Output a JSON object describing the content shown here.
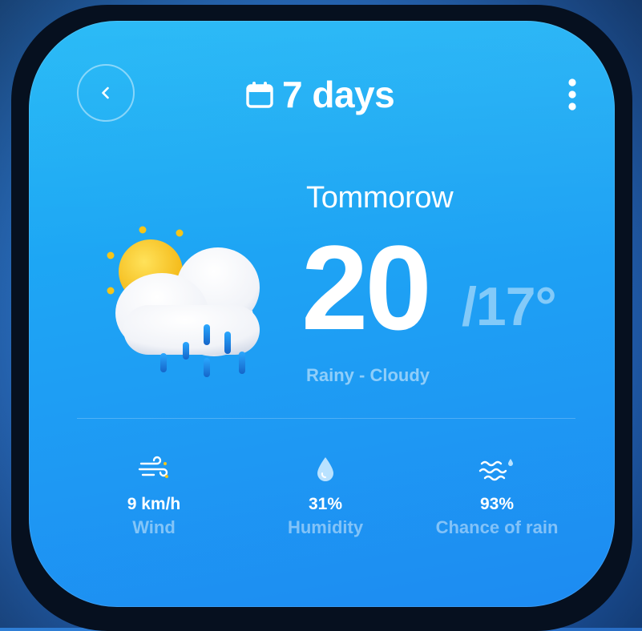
{
  "header": {
    "title": "7 days",
    "back_icon": "chevron-left-icon",
    "calendar_icon": "calendar-icon",
    "menu_icon": "more-vertical-icon"
  },
  "forecast": {
    "day": "Tommorow",
    "temp_high": "20",
    "temp_low": "/17°",
    "condition": "Rainy - Cloudy",
    "illustration": "sun-cloud-rain-icon"
  },
  "stats": [
    {
      "icon": "wind-icon",
      "value": "9 km/h",
      "label": "Wind"
    },
    {
      "icon": "droplet-icon",
      "value": "31%",
      "label": "Humidity"
    },
    {
      "icon": "rain-waves-icon",
      "value": "93%",
      "label": "Chance of rain"
    }
  ],
  "colors": {
    "card_top": "#1ab6f5",
    "card_bottom": "#1d8bf2",
    "sun": "#f5c518",
    "rain": "#1e7fe0"
  }
}
